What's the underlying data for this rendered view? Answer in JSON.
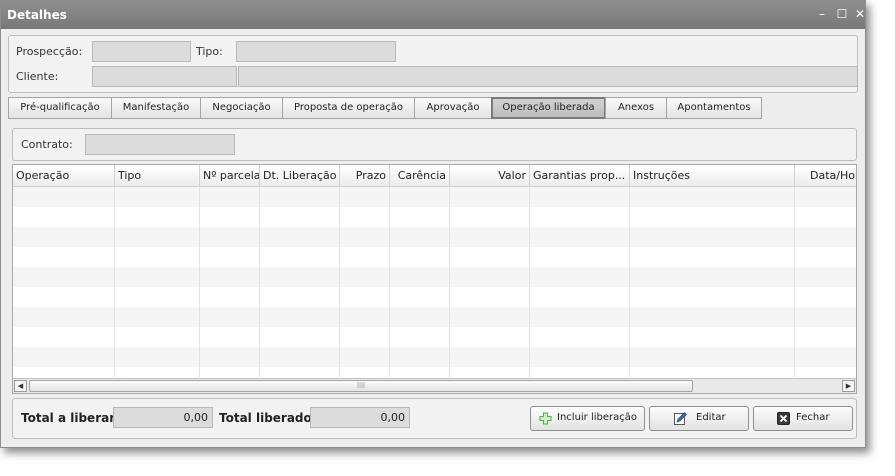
{
  "window": {
    "title": "Detalhes",
    "controls": {
      "minimize": "–",
      "maximize": "☐",
      "close": "✕"
    }
  },
  "header": {
    "prospeccao_label": "Prospecção:",
    "prospeccao_value": "",
    "tipo_label": "Tipo:",
    "tipo_value": "",
    "cliente_label": "Cliente:",
    "cliente_code": "",
    "cliente_name": ""
  },
  "tabs": [
    {
      "label": "Pré-qualificação"
    },
    {
      "label": "Manifestação"
    },
    {
      "label": "Negociação"
    },
    {
      "label": "Proposta de operação"
    },
    {
      "label": "Aprovação"
    },
    {
      "label": "Operação liberada"
    },
    {
      "label": "Anexos"
    },
    {
      "label": "Apontamentos"
    }
  ],
  "active_tab": "Operação liberada",
  "contrato": {
    "label": "Contrato:",
    "value": ""
  },
  "table": {
    "columns": [
      "Operação",
      "Tipo",
      "Nº parcela",
      "Dt. Liberação",
      "Prazo",
      "Carência",
      "Valor",
      "Garantias prop...",
      "Instruções",
      "Data/Ho"
    ],
    "rows": []
  },
  "scrollbar": {
    "grip": "||||"
  },
  "footer": {
    "total_liberar_label": "Total a liberar:",
    "total_liberar_value": "0,00",
    "total_liberado_label": "Total liberado:",
    "total_liberado_value": "0,00",
    "incluir_label": "Incluir liberação",
    "editar_label": "Editar",
    "fechar_label": "Fechar"
  },
  "colors": {
    "titlebar": "#808080",
    "accent_add": "#4caf50",
    "edit_icon": "#3a6fb0"
  },
  "icons": {
    "add": "plus-icon",
    "edit": "pencil-icon",
    "close": "close-x-icon"
  }
}
